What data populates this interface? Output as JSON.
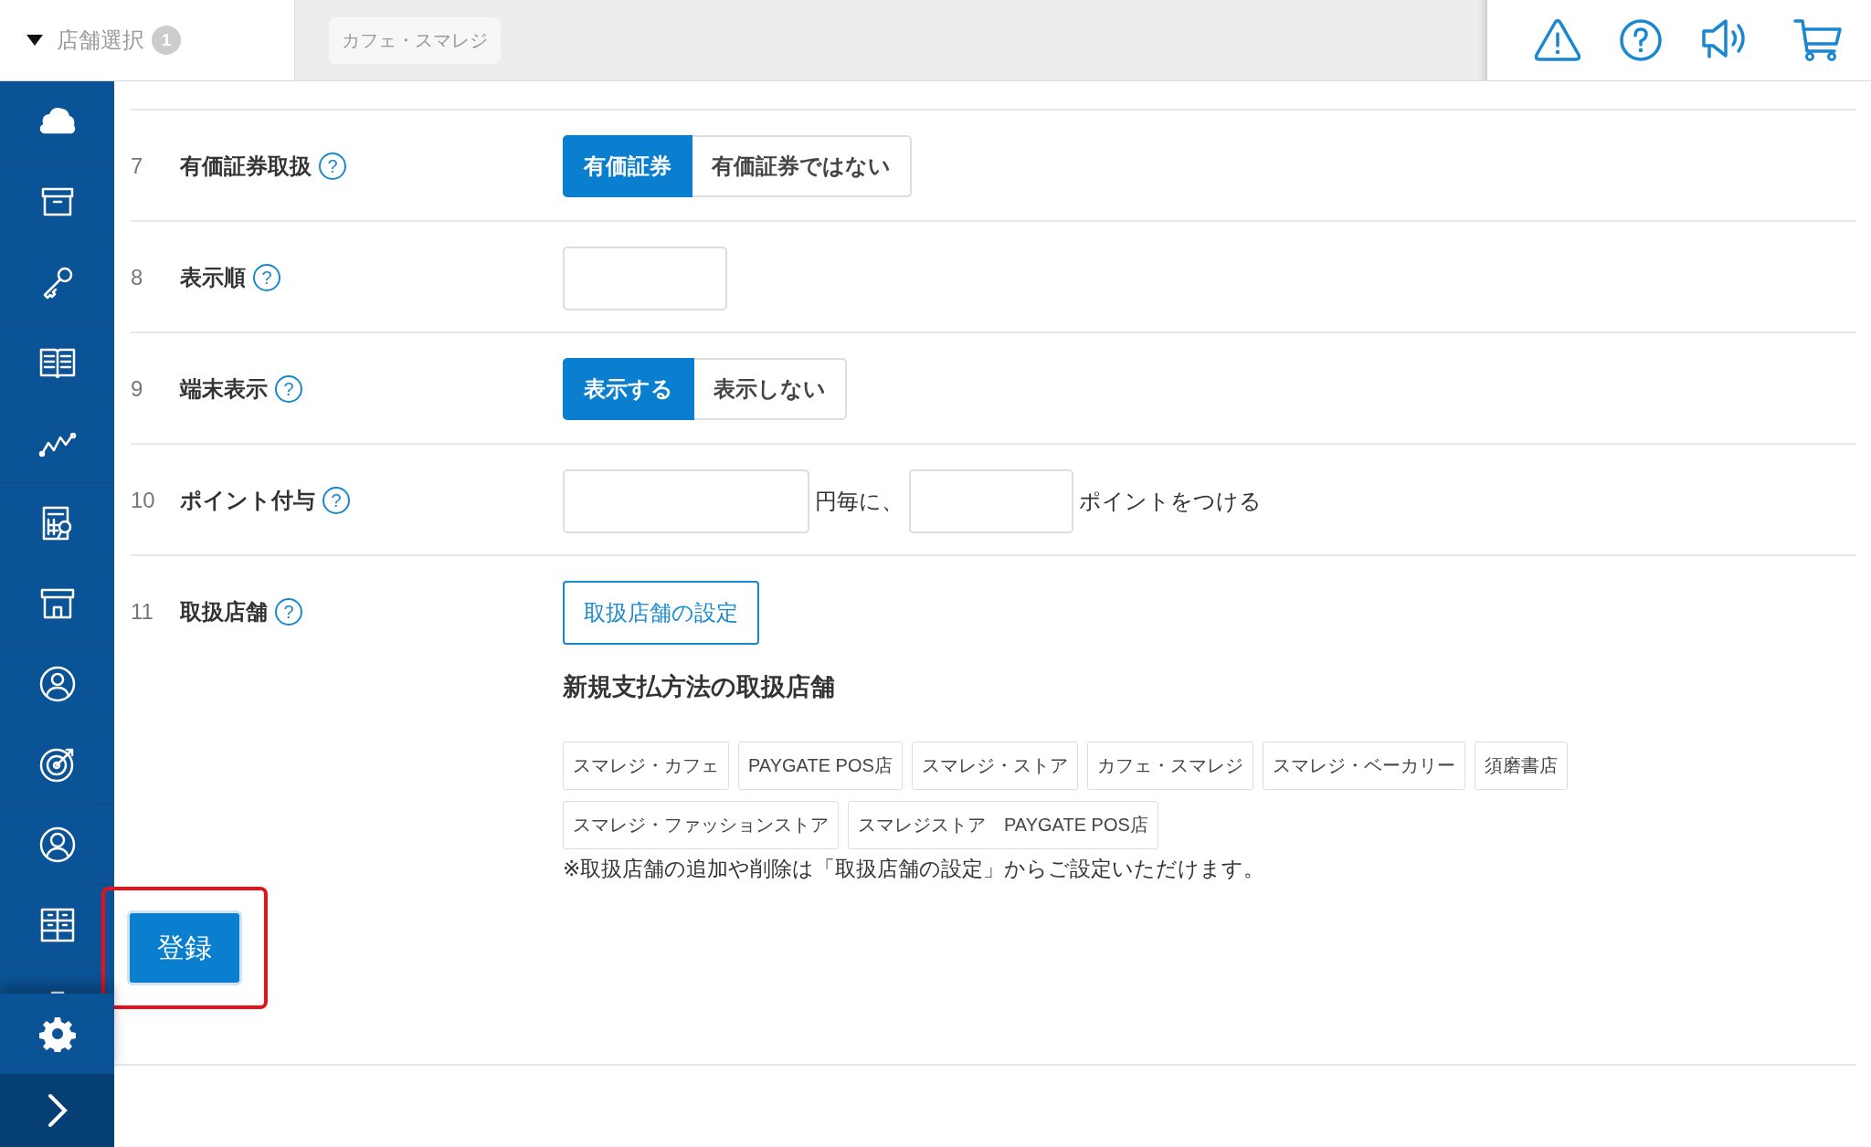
{
  "header": {
    "store_selector": {
      "label": "店舗選択",
      "count": "1",
      "expanded": true
    },
    "store_chip": "カフェ・スマレジ"
  },
  "rows": [
    {
      "number": "7",
      "label": "有価証券取扱",
      "help": "?",
      "kind": "segmented",
      "options": [
        {
          "label": "有価証券",
          "selected": true
        },
        {
          "label": "有価証券ではない",
          "selected": false
        }
      ]
    },
    {
      "number": "8",
      "label": "表示順",
      "help": "?",
      "kind": "input"
    },
    {
      "number": "9",
      "label": "端末表示",
      "help": "?",
      "kind": "segmented",
      "options": [
        {
          "label": "表示する",
          "selected": true
        },
        {
          "label": "表示しない",
          "selected": false
        }
      ]
    },
    {
      "number": "10",
      "label": "ポイント付与",
      "help": "?",
      "kind": "points",
      "per_text": "円毎に、",
      "suffix_text": "ポイントをつける"
    },
    {
      "number": "11",
      "label": "取扱店舗",
      "help": "?",
      "kind": "stores",
      "button": "取扱店舗の設定",
      "heading": "新規支払方法の取扱店舗",
      "tags": [
        "スマレジ・カフェ",
        "PAYGATE POS店",
        "スマレジ・ストア",
        "カフェ・スマレジ",
        "スマレジ・ベーカリー",
        "須磨書店",
        "スマレジ・ファッションストア",
        "スマレジストア　PAYGATE POS店"
      ],
      "note": "※取扱店舗の追加や削除は「取扱店舗の設定」からご設定いただけます。"
    }
  ],
  "submit": {
    "label": "登録",
    "highlighted": true
  }
}
